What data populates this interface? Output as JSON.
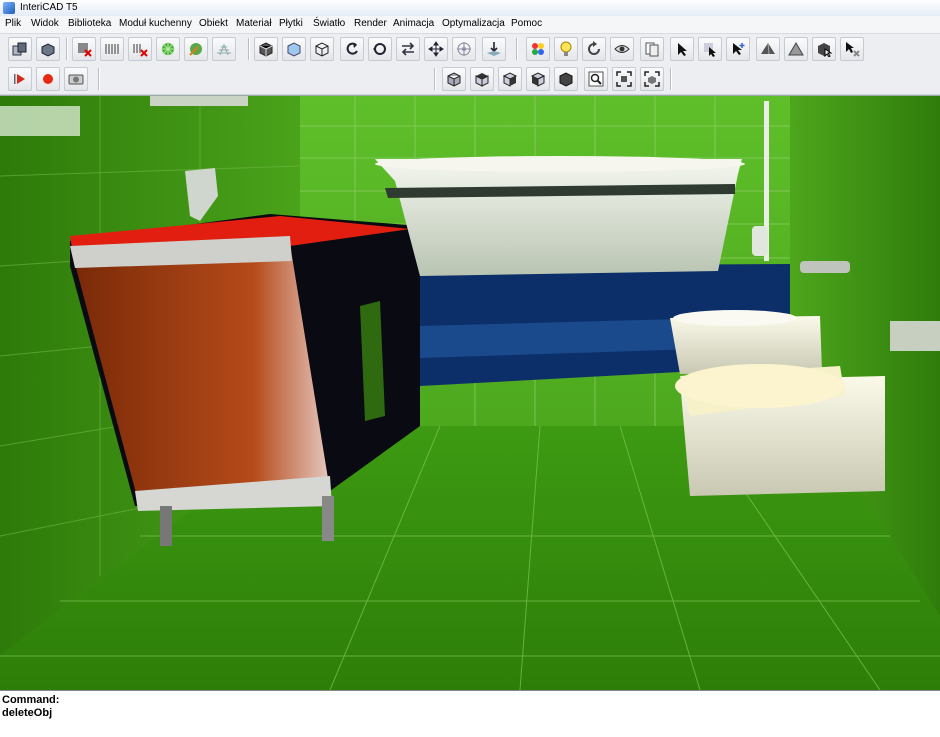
{
  "window": {
    "title": "InteriCAD T5"
  },
  "menu": [
    "Plik",
    "Widok",
    "Biblioteka",
    "Moduł kuchenny",
    "Obiekt",
    "Materiał",
    "Płytki",
    "Światło",
    "Render",
    "Animacja",
    "Optymalizacja",
    "Pomoc"
  ],
  "toolbar1": {
    "groups": [
      [
        "copy-objects-icon",
        "paste-objects-icon"
      ],
      [
        "delete-wall-icon",
        "wall-pattern-icon",
        "delete-pattern-icon",
        "burst-green-icon",
        "burst-orange-icon",
        "floor-grid-icon"
      ],
      [
        "cube-view-icon",
        "box-view-icon",
        "wire-cube-icon",
        "rotate-left-icon",
        "rotate-orbit-icon",
        "swap-icon",
        "move-icon",
        "target-icon",
        "download-icon"
      ],
      [
        "color-balls-icon",
        "light-bulb-icon",
        "refresh-icon",
        "eye-view-icon",
        "pages-icon"
      ],
      [
        "select-arrow-icon",
        "select-box-icon",
        "select-arrow-plus-icon",
        "pyramid-icon",
        "triangle-icon",
        "group-select-icon",
        "cancel-select-icon"
      ]
    ]
  },
  "toolbar2": {
    "left": [
      "play-icon",
      "record-icon",
      "camera-icon"
    ],
    "right": [
      "view-front-icon",
      "view-top-icon",
      "view-right-icon",
      "view-back-icon",
      "view-iso-icon",
      "zoom-window-icon",
      "zoom-extents-icon",
      "zoom-all-icon"
    ]
  },
  "command": {
    "label": "Command:",
    "value": "deleteObj"
  }
}
